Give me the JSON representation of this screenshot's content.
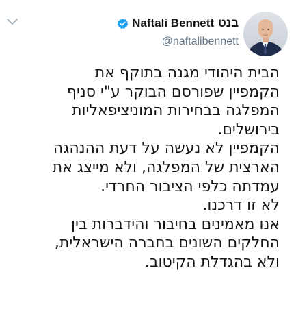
{
  "tweet": {
    "author": {
      "name_en": "Naftali Bennett",
      "name_he": "בנט",
      "handle": "@naftalibennett",
      "verified_color": "#1da1f2"
    },
    "menu_icon": "chevron-down-icon",
    "lines": [
      "הבית היהודי מגנה בתוקף את",
      "הקמפיין שפורסם הבוקר ע\"י סניף",
      "המפלגה בבחירות המוניציפאליות",
      "בירושלים.",
      "הקמפיין לא נעשה על דעת ההנהגה",
      "הארצית של המפלגה, ולא מייצג את",
      "עמדתה כלפי הציבור החרדי.",
      "לא זו דרכנו.",
      "אנו מאמינים בחיבור והידברות בין",
      "החלקים השונים בחברה הישראלית,",
      "ולא בהגדלת הקיטוב."
    ]
  }
}
